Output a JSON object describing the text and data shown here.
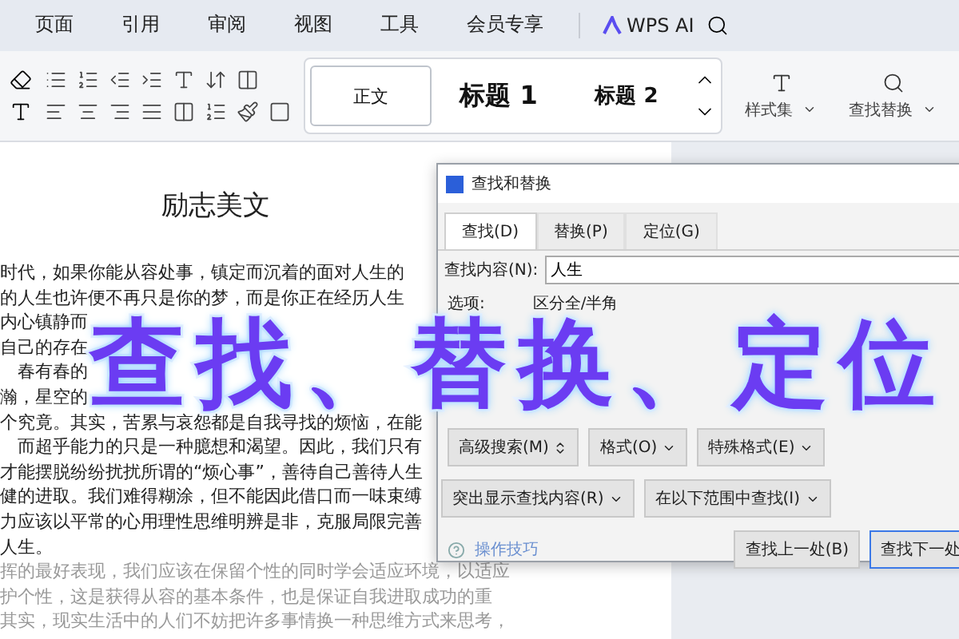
{
  "menu_tabs": [
    {
      "label": "页面",
      "selected": false
    },
    {
      "label": "引用",
      "selected": false
    },
    {
      "label": "审阅",
      "selected": false
    },
    {
      "label": "视图",
      "selected": false
    },
    {
      "label": "工具",
      "selected": false
    },
    {
      "label": "会员专享",
      "selected": false
    }
  ],
  "ai_button": "WPS AI",
  "styles": [
    {
      "label": "正文",
      "kind": "normal",
      "selected": true
    },
    {
      "label": "标题 1",
      "kind": "h1",
      "selected": false
    },
    {
      "label": "标题 2",
      "kind": "h2",
      "selected": false
    }
  ],
  "style_set": "样式集",
  "find_replace": "查找替换",
  "document": {
    "title": "励志美文",
    "lines": [
      {
        "segments": [
          "时代，如果你能从容处事，镇定而沉着的面对人生的"
        ],
        "faded": false
      },
      {
        "segments": [
          "的人生也许便不再只是你的梦，而是你正在经历人生"
        ],
        "faded": false
      },
      {
        "segments": [
          "内心镇静而"
        ],
        "faded": false
      },
      {
        "segments": [
          "自己的存在"
        ],
        "faded": false
      },
      {
        "segments": [
          "　春有春的"
        ],
        "faded": false
      },
      {
        "segments": [
          "瀚，星空的"
        ],
        "faded": false
      },
      {
        "segments": [
          "个究竟。其实，苦累与哀怨都是自我寻找的烦恼，在能"
        ],
        "faded": false
      },
      {
        "segments": [
          "　而超乎能力的只是一种臆想和渴望。因此，我们只有"
        ],
        "faded": false
      },
      {
        "segments": [
          "才能摆脱纷纷扰扰所谓的“烦心事”，善待自己善待人生"
        ],
        "faded": false
      },
      {
        "segments": [
          "健的进取。我们难得糊涂，但不能因此借口而一味束缚"
        ],
        "faded": false
      },
      {
        "segments": [
          "力应该以平常的心用理性思维明辨是非，克服局限完善"
        ],
        "faded": false
      },
      {
        "segments": [
          "人生。"
        ],
        "faded": false
      },
      {
        "segments": [
          "挥的最好表现，我们应该在保留个性的同时学会适应环境，以适应"
        ],
        "faded": true
      },
      {
        "segments": [
          "护个性，这是获得从容的基本条件，也是保证自我进取成功的重"
        ],
        "faded": true
      },
      {
        "segments": [
          "其实，现实生活中的人们不妨把许多事情换一种思维方式来思考，"
        ],
        "faded": true
      }
    ]
  },
  "dialog": {
    "title": "查找和替换",
    "tabs": [
      {
        "label": "查找(D)",
        "selected": true
      },
      {
        "label": "替换(P)",
        "selected": false
      },
      {
        "label": "定位(G)",
        "selected": false
      }
    ],
    "find_label": "查找内容(N):",
    "find_value": "人生",
    "options_label": "选项:",
    "options_value": "区分全/半角",
    "row1": [
      {
        "label": "高级搜索(M)",
        "kind": "toggle"
      },
      {
        "label": "格式(O)",
        "kind": "dropdown"
      },
      {
        "label": "特殊格式(E)",
        "kind": "dropdown"
      }
    ],
    "row2": [
      {
        "label": "突出显示查找内容(R)",
        "kind": "dropdown"
      },
      {
        "label": "在以下范围中查找(I)",
        "kind": "dropdown"
      }
    ],
    "tips_link": "操作技巧",
    "actions": [
      {
        "label": "查找上一处(B)",
        "selected": false
      },
      {
        "label": "查找下一处",
        "selected": true
      }
    ]
  },
  "overlay_title": "查找、替换、定位"
}
